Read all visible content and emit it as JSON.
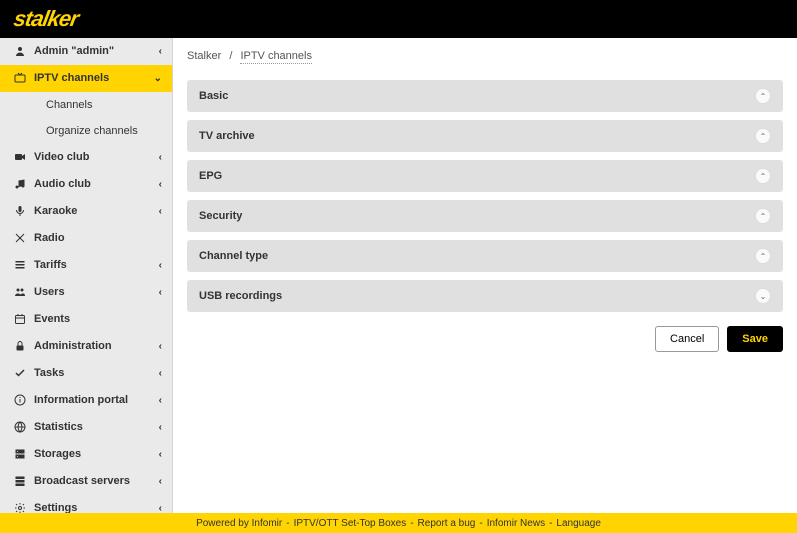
{
  "logo": "stalker",
  "sidebar": {
    "items": [
      {
        "icon": "user",
        "label": "Admin \"admin\"",
        "chev": "left",
        "active": false
      },
      {
        "icon": "tv",
        "label": "IPTV channels",
        "chev": "down",
        "active": true,
        "subs": [
          "Channels",
          "Organize channels"
        ]
      },
      {
        "icon": "video",
        "label": "Video club",
        "chev": "left"
      },
      {
        "icon": "music",
        "label": "Audio club",
        "chev": "left"
      },
      {
        "icon": "mic",
        "label": "Karaoke",
        "chev": "left"
      },
      {
        "icon": "radio",
        "label": "Radio",
        "chev": ""
      },
      {
        "icon": "list",
        "label": "Tariffs",
        "chev": "left"
      },
      {
        "icon": "users",
        "label": "Users",
        "chev": "left"
      },
      {
        "icon": "calendar",
        "label": "Events",
        "chev": ""
      },
      {
        "icon": "lock",
        "label": "Administration",
        "chev": "left"
      },
      {
        "icon": "check",
        "label": "Tasks",
        "chev": "left"
      },
      {
        "icon": "info",
        "label": "Information portal",
        "chev": "left"
      },
      {
        "icon": "globe",
        "label": "Statistics",
        "chev": "left"
      },
      {
        "icon": "storage",
        "label": "Storages",
        "chev": "left"
      },
      {
        "icon": "server",
        "label": "Broadcast servers",
        "chev": "left"
      },
      {
        "icon": "gear",
        "label": "Settings",
        "chev": "left"
      }
    ]
  },
  "breadcrumb": {
    "parent": "Stalker",
    "current": "IPTV channels"
  },
  "panels": [
    {
      "title": "Basic",
      "dir": "up"
    },
    {
      "title": "TV archive",
      "dir": "up"
    },
    {
      "title": "EPG",
      "dir": "up"
    },
    {
      "title": "Security",
      "dir": "up"
    },
    {
      "title": "Channel type",
      "dir": "up"
    },
    {
      "title": "USB recordings",
      "dir": "down"
    }
  ],
  "buttons": {
    "cancel": "Cancel",
    "save": "Save"
  },
  "footer": {
    "parts": [
      "Powered by Infomir",
      "IPTV/OTT Set-Top Boxes",
      "Report a bug",
      "Infomir News",
      "Language"
    ]
  }
}
